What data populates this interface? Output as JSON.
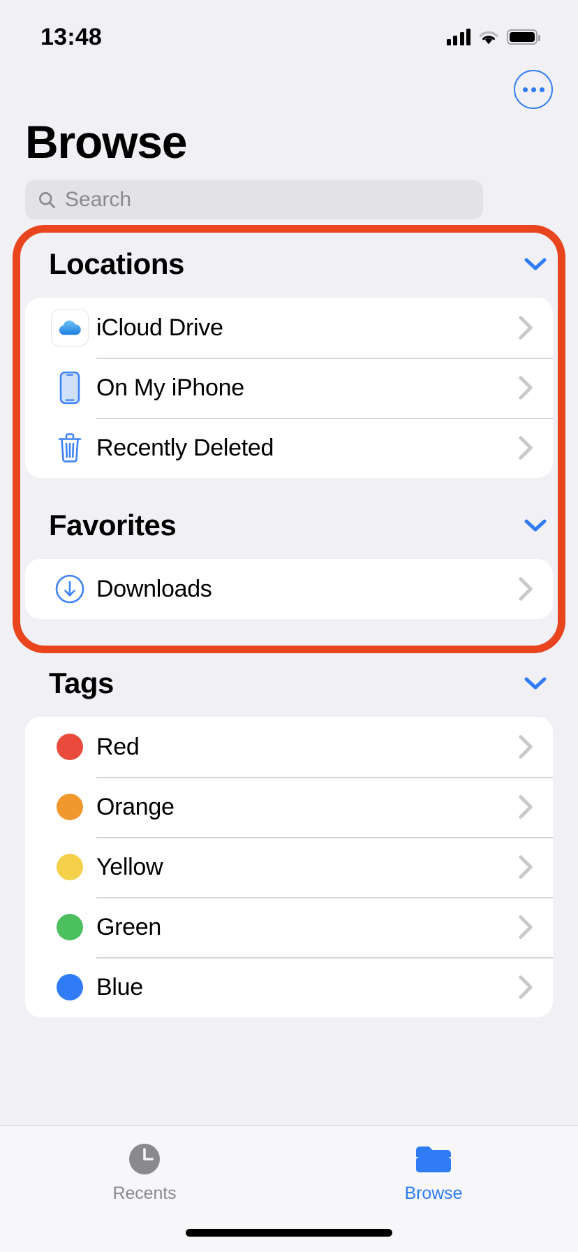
{
  "status_bar": {
    "time": "13:48",
    "cellular_icon": "cellular-bars-icon",
    "wifi_icon": "wifi-icon",
    "battery_icon": "battery-full-icon"
  },
  "header": {
    "title": "Browse",
    "more_button_icon": "ellipsis-circle-icon"
  },
  "search": {
    "placeholder": "Search",
    "icon": "search-icon",
    "value": ""
  },
  "sections": [
    {
      "title": "Locations",
      "collapse_icon": "chevron-down-icon",
      "highlighted": true,
      "items": [
        {
          "label": "iCloud Drive",
          "icon": "icloud-drive-icon",
          "chevron": "chevron-right-icon"
        },
        {
          "label": "On My iPhone",
          "icon": "iphone-icon",
          "chevron": "chevron-right-icon"
        },
        {
          "label": "Recently Deleted",
          "icon": "trash-icon",
          "chevron": "chevron-right-icon"
        }
      ]
    },
    {
      "title": "Favorites",
      "collapse_icon": "chevron-down-icon",
      "highlighted": true,
      "items": [
        {
          "label": "Downloads",
          "icon": "download-circle-icon",
          "chevron": "chevron-right-icon"
        }
      ]
    },
    {
      "title": "Tags",
      "collapse_icon": "chevron-down-icon",
      "highlighted": false,
      "items": [
        {
          "label": "Red",
          "icon": "tag-dot-icon",
          "color": "#E84B3C",
          "chevron": "chevron-right-icon"
        },
        {
          "label": "Orange",
          "icon": "tag-dot-icon",
          "color": "#F0982D",
          "chevron": "chevron-right-icon"
        },
        {
          "label": "Yellow",
          "icon": "tag-dot-icon",
          "color": "#F5D04A",
          "chevron": "chevron-right-icon"
        },
        {
          "label": "Green",
          "icon": "tag-dot-icon",
          "color": "#4CBF5F",
          "chevron": "chevron-right-icon"
        },
        {
          "label": "Blue",
          "icon": "tag-dot-icon",
          "color": "#2F7CF6",
          "chevron": "chevron-right-icon"
        }
      ]
    }
  ],
  "annotation": {
    "color": "#E8441E",
    "covers": "Locations and Favorites sections"
  },
  "tab_bar": {
    "tabs": [
      {
        "label": "Recents",
        "icon": "clock-icon",
        "active": false
      },
      {
        "label": "Browse",
        "icon": "folder-icon",
        "active": true
      }
    ]
  },
  "colors": {
    "accent": "#2F7CF6",
    "background": "#F1F1F5",
    "card": "#FFFFFF",
    "annotation": "#E8441E",
    "separator": "#D6D6DA",
    "secondary_text": "#8A8A8E"
  }
}
